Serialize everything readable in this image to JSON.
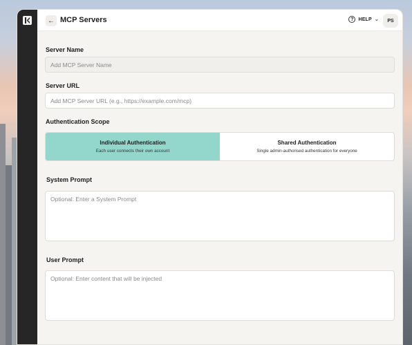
{
  "header": {
    "back_icon": "arrow-left-icon",
    "title": "MCP Servers",
    "help_label": "HELP",
    "avatar_initials": "PS"
  },
  "form": {
    "server_name": {
      "label": "Server Name",
      "placeholder": "Add MCP Server Name"
    },
    "server_url": {
      "label": "Server URL",
      "placeholder": "Add MCP Server URL (e.g., https://example.com/mcp)"
    },
    "auth_scope": {
      "label": "Authentication Scope",
      "options": [
        {
          "title": "Individual Authentication",
          "subtitle": "Each user connects their own account",
          "selected": true
        },
        {
          "title": "Shared Authentication",
          "subtitle": "Single admin-authorised authentication for everyone",
          "selected": false
        }
      ]
    },
    "system_prompt": {
      "label": "System Prompt",
      "placeholder": "Optional: Enter a System Prompt"
    },
    "user_prompt": {
      "label": "User Prompt",
      "placeholder": "Optional: Enter content that will be injected"
    }
  },
  "colors": {
    "accent": "#93d6cc",
    "rail": "#262626",
    "panel": "#f5f4f1"
  }
}
